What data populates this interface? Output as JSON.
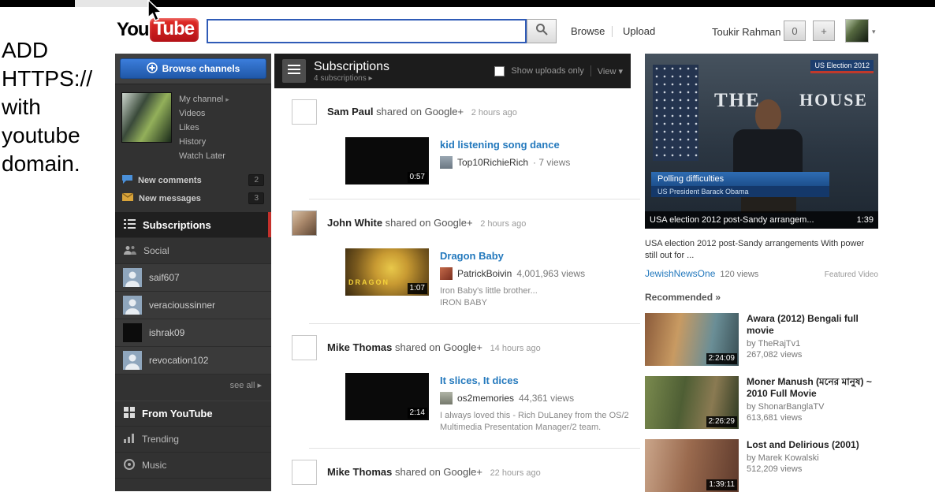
{
  "colors": {
    "brand_red": "#cc181e",
    "link_blue": "#2479bd",
    "button_blue": "#2a66b8",
    "accent_red": "#c4302b"
  },
  "icons": {
    "caret_down": "▾",
    "caret_right": "▸",
    "double_right": "»",
    "plus": "+",
    "pipe": "|"
  },
  "annotation": {
    "lines": [
      "ADD",
      "HTTPS://",
      "with",
      "youtube",
      "domain."
    ]
  },
  "header": {
    "logo_you": "You",
    "logo_tube": "Tube",
    "search_placeholder": "",
    "browse_label": "Browse",
    "upload_label": "Upload",
    "username": "Toukir Rahman",
    "notification_count": "0",
    "add_label": "+"
  },
  "sidebar": {
    "browse_channels_label": "Browse channels",
    "profile_links": [
      "My channel",
      "Videos",
      "Likes",
      "History",
      "Watch Later"
    ],
    "alerts": [
      {
        "label": "New comments",
        "count": "2"
      },
      {
        "label": "New messages",
        "count": "3"
      }
    ],
    "nav_subscriptions": "Subscriptions",
    "nav_social": "Social",
    "subscriptions": [
      "saif607",
      "veracioussinner",
      "ishrak09",
      "revocation102"
    ],
    "see_all": "see all",
    "from_youtube": "From YouTube",
    "trending": "Trending",
    "music": "Music"
  },
  "feed": {
    "title": "Subscriptions",
    "subtitle": "4 subscriptions",
    "show_uploads_only": "Show uploads only",
    "view_label": "View",
    "items": [
      {
        "user": "Sam Paul",
        "action": "shared on Google+",
        "time": "2 hours ago",
        "video_title": "kid listening song dance",
        "channel": "Top10RichieRich",
        "views": "· 7 views",
        "duration": "0:57",
        "description": ""
      },
      {
        "user": "John White",
        "action": "shared on Google+",
        "time": "2 hours ago",
        "video_title": "Dragon Baby",
        "channel": "PatrickBoivin",
        "views": "4,001,963 views",
        "duration": "1:07",
        "thumb_text": "DRAGON",
        "description": "Iron Baby's little brother...\nIRON BABY"
      },
      {
        "user": "Mike Thomas",
        "action": "shared on Google+",
        "time": "14 hours ago",
        "video_title": "It slices, It dices",
        "channel": "os2memories",
        "views": "44,361 views",
        "duration": "2:14",
        "description": "I always loved this - Rich DuLaney from the OS/2 Multimedia Presentation Manager/2 team."
      },
      {
        "user": "Mike Thomas",
        "action": "shared on Google+",
        "time": "22 hours ago"
      }
    ]
  },
  "featured": {
    "badge": "US Election 2012",
    "player_text_1": "THE",
    "player_text_2": "HOUSE",
    "caption_main": "Polling difficulties",
    "caption_sub": "US President Barack Obama",
    "bar_title": "USA election 2012 post-Sandy arrangem...",
    "duration": "1:39",
    "description": "USA election 2012 post-Sandy arrangements With power still out for ...",
    "channel": "JewishNewsOne",
    "views": "120 views",
    "tag": "Featured Video"
  },
  "recommended": {
    "heading": "Recommended",
    "items": [
      {
        "title": "Awara (2012) Bengali full movie",
        "by": "by TheRajTv1",
        "views": "267,082 views",
        "duration": "2:24:09"
      },
      {
        "title": "Moner Manush (মনের মানুষ) ~ 2010 Full Movie",
        "by": "by ShonarBanglaTV",
        "views": "613,681 views",
        "duration": "2:26:29"
      },
      {
        "title": "Lost and Delirious (2001)",
        "by": "by Marek Kowalski",
        "views": "512,209 views",
        "duration": "1:39:11"
      }
    ]
  }
}
